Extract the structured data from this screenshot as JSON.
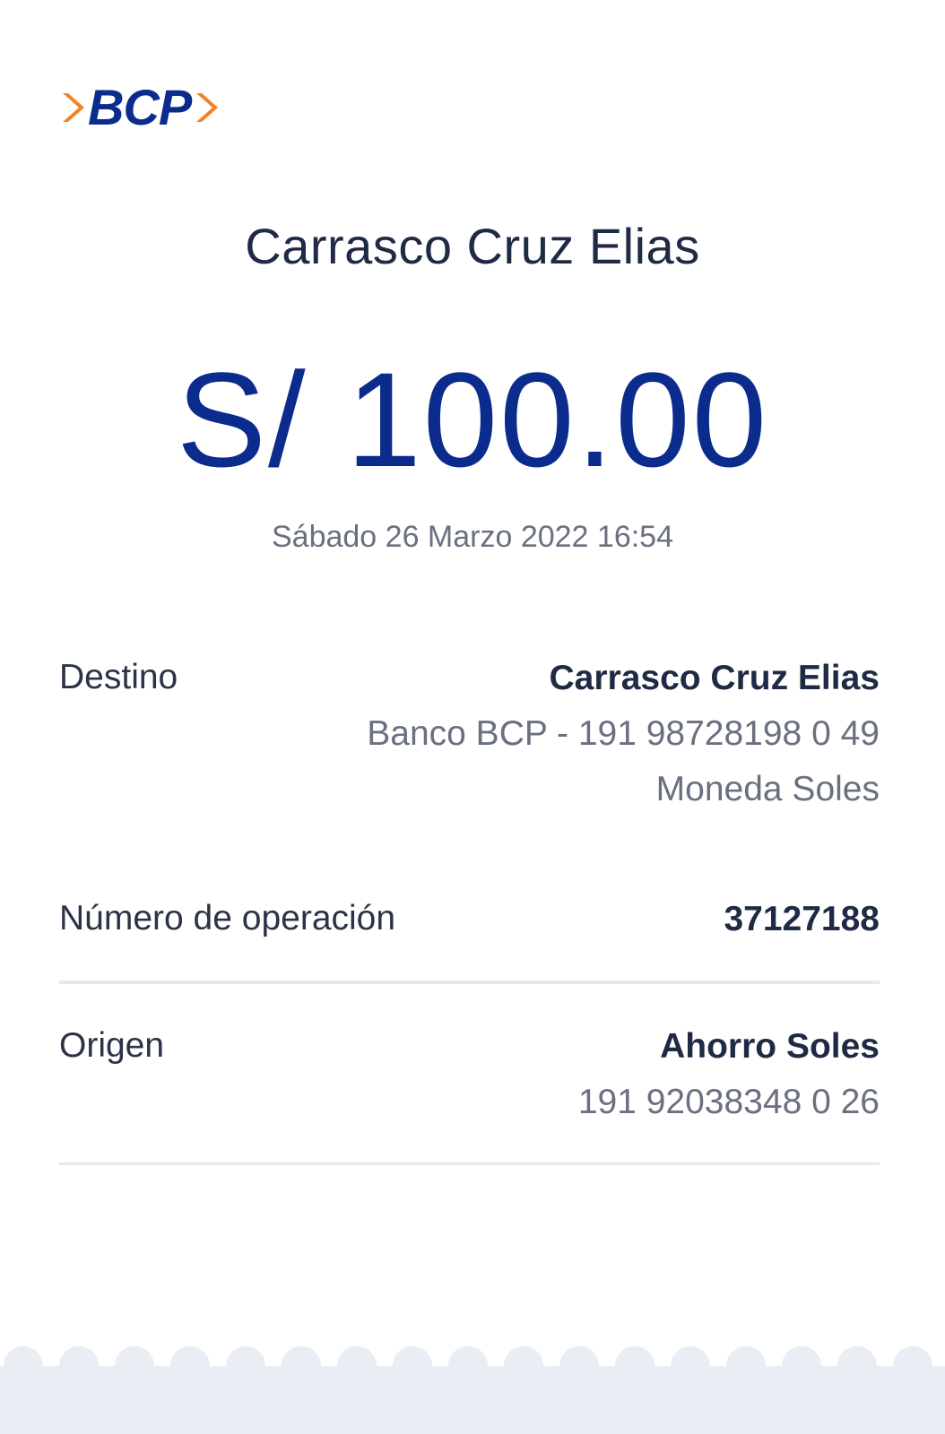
{
  "brand": {
    "logo_text": "BCP",
    "primary_color": "#0b2c8c",
    "accent_color": "#f58220"
  },
  "header": {
    "recipient_name": "Carrasco Cruz Elias",
    "amount": "S/ 100.00",
    "datetime": "Sábado 26 Marzo 2022 16:54"
  },
  "details": {
    "destino": {
      "label": "Destino",
      "name": "Carrasco Cruz Elias",
      "account": "Banco BCP - 191 98728198 0 49",
      "currency": "Moneda Soles"
    },
    "operacion": {
      "label": "Número de operación",
      "number": "37127188"
    },
    "origen": {
      "label": "Origen",
      "account_type": "Ahorro Soles",
      "account_number": "191 92038348 0 26"
    }
  }
}
